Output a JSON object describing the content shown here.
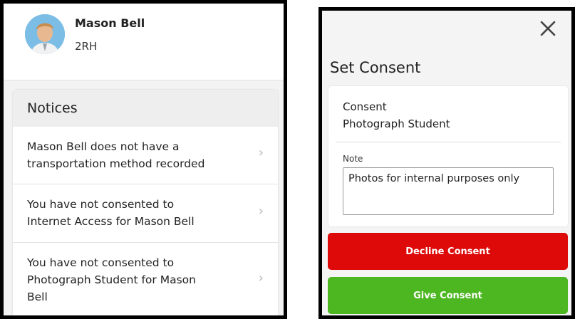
{
  "student": {
    "name": "Mason Bell",
    "class": "2RH"
  },
  "notices": {
    "title": "Notices",
    "items": [
      {
        "line1": "Mason Bell does not have a",
        "line2": "transportation method recorded"
      },
      {
        "line1": "You have not consented to",
        "line2": "Internet Access for Mason Bell"
      },
      {
        "line1": "You have not consented to",
        "line2": "Photograph Student for Mason",
        "line3": "Bell"
      }
    ]
  },
  "modal": {
    "title": "Set Consent",
    "consent_label": "Consent",
    "consent_value": "Photograph Student",
    "note_label": "Note",
    "note_value": "Photos for internal purposes only",
    "decline_label": "Decline Consent",
    "give_label": "Give Consent"
  },
  "colors": {
    "decline": "#dd0a09",
    "give": "#4db722"
  },
  "icons": {
    "close": "close-icon",
    "chevron": "chevron-right-icon"
  }
}
